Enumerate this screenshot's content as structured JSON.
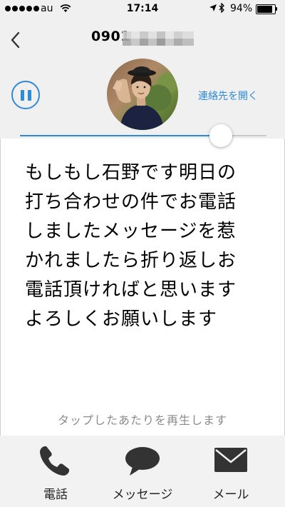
{
  "status_bar": {
    "carrier": "au",
    "time": "17:14",
    "battery": "94%",
    "battery_level": 0.94
  },
  "header": {
    "phone_number_visible": "0901",
    "open_contact_label": "連絡先を開く",
    "playback_progress": 0.815
  },
  "transcript": {
    "lines": [
      "もしもし石野です明日の",
      "打ち合わせの件でお電話",
      "しましたメッセージを惹",
      "かれましたら折り返しお",
      "電話頂ければと思います",
      "よろしくお願いします"
    ]
  },
  "hint": "タップしたあたりを再生します",
  "tabbar": {
    "phone_label": "電話",
    "message_label": "メッセージ",
    "mail_label": "メール"
  },
  "colors": {
    "accent": "#2e8bd8",
    "icon": "#333333",
    "hint_text": "#8a8a8a"
  }
}
